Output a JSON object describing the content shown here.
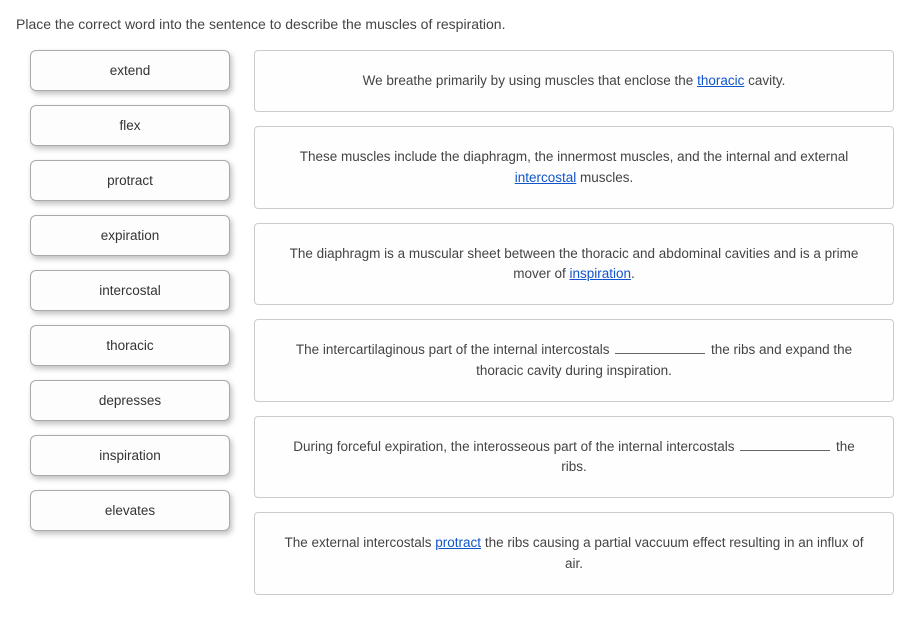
{
  "instructions": "Place the correct word into the sentence to describe the muscles of respiration.",
  "word_bank": [
    {
      "label": "extend"
    },
    {
      "label": "flex"
    },
    {
      "label": "protract"
    },
    {
      "label": "expiration"
    },
    {
      "label": "intercostal"
    },
    {
      "label": "thoracic"
    },
    {
      "label": "depresses"
    },
    {
      "label": "inspiration"
    },
    {
      "label": "elevates"
    }
  ],
  "sentences": [
    {
      "pre": "We breathe primarily by using muscles that enclose the ",
      "blank": "thoracic",
      "post": " cavity.",
      "filled": true
    },
    {
      "pre": "These muscles include the diaphragm, the innermost muscles, and the internal and external ",
      "blank": "intercostal",
      "post": " muscles.",
      "filled": true
    },
    {
      "pre": "The diaphragm is a muscular sheet between the thoracic and abdominal cavities and is a prime mover of ",
      "blank": "inspiration",
      "post": ".",
      "filled": true
    },
    {
      "pre": "The intercartilaginous part of the internal intercostals ",
      "blank": "",
      "post": " the ribs and expand the thoracic cavity during inspiration.",
      "filled": false
    },
    {
      "pre": "During forceful expiration, the interosseous part of the internal intercostals ",
      "blank": "",
      "post": " the ribs.",
      "filled": false
    },
    {
      "pre": "The external intercostals ",
      "blank": "protract",
      "post": " the ribs causing a partial vaccuum effect resulting in an influx of air.",
      "filled": true
    }
  ]
}
